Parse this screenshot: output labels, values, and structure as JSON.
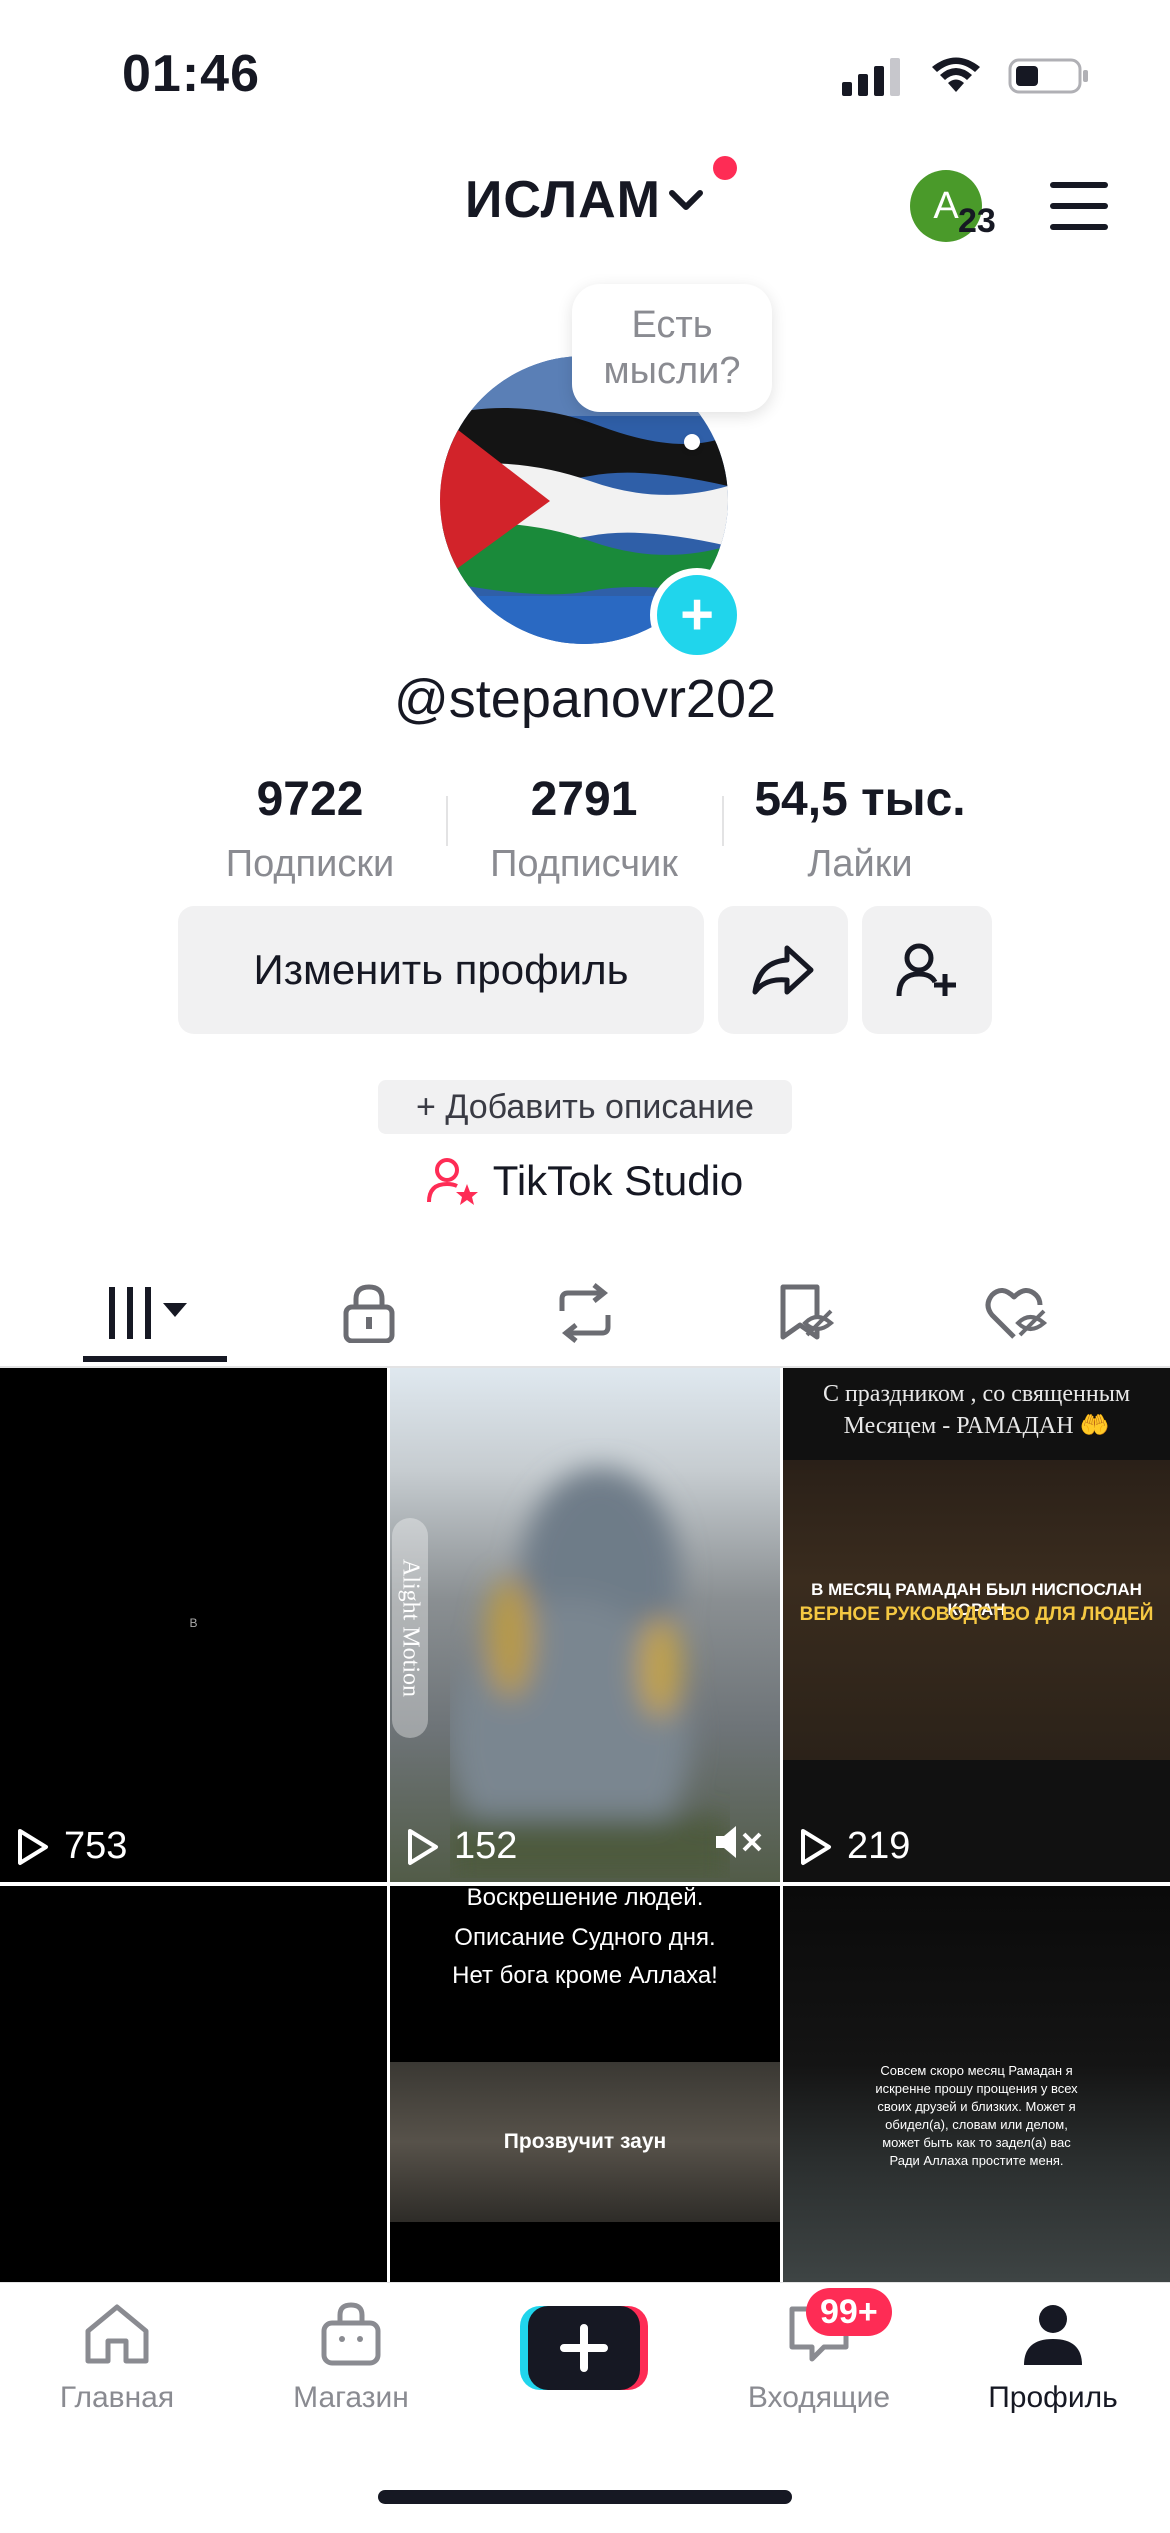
{
  "status_bar": {
    "time": "01:46"
  },
  "header": {
    "title": "ИСЛАМ",
    "avatar_letter": "A",
    "avatar_badge": "23"
  },
  "profile": {
    "thought_bubble": "Есть мысли?",
    "username": "@stepanovr202",
    "stats": [
      {
        "value": "9722",
        "label": "Подписки"
      },
      {
        "value": "2791",
        "label": "Подписчик"
      },
      {
        "value": "54,5 тыс.",
        "label": "Лайки"
      }
    ],
    "edit_profile_label": "Изменить профиль",
    "add_description_label": "+ Добавить описание",
    "studio_label": "TikTok Studio"
  },
  "tabs": [
    "videos-icon",
    "lock-icon",
    "repost-icon",
    "saved-icon",
    "liked-icon"
  ],
  "videos": [
    {
      "views": "753",
      "text": "B"
    },
    {
      "views": "152",
      "watermark": "Alight Motion"
    },
    {
      "views": "219",
      "top_text": "С праздником , со священным Месяцем - РАМАДАН 🤲",
      "line1": "В МЕСЯЦ РАМАДАН БЫЛ НИСПОСЛАН КОРАН",
      "line2": "ВЕРНОЕ РУКОВОДСТВО ДЛЯ ЛЮДЕЙ"
    },
    {
      "views": ""
    },
    {
      "views": "",
      "line1": "Воскрешение людей.",
      "line2": "Описание Судного дня.",
      "line3": "Нет бога кроме Аллаха!",
      "mid": "Прозвучит заун"
    },
    {
      "views": "",
      "text": "Совсем скоро месяц Рамадан я искренне прошу прощения у всех своих друзей и близких. Может я обидел(а), словам или делом, может быть как то задел(а) вас Ради Аллаха простите меня."
    }
  ],
  "bottom_nav": {
    "home": "Главная",
    "shop": "Магазин",
    "inbox": "Входящие",
    "inbox_badge": "99+",
    "profile": "Профиль"
  },
  "colors": {
    "accent": "#fe2c55",
    "cyan": "#20d5ec",
    "text": "#161823",
    "muted": "#8a8b91"
  }
}
